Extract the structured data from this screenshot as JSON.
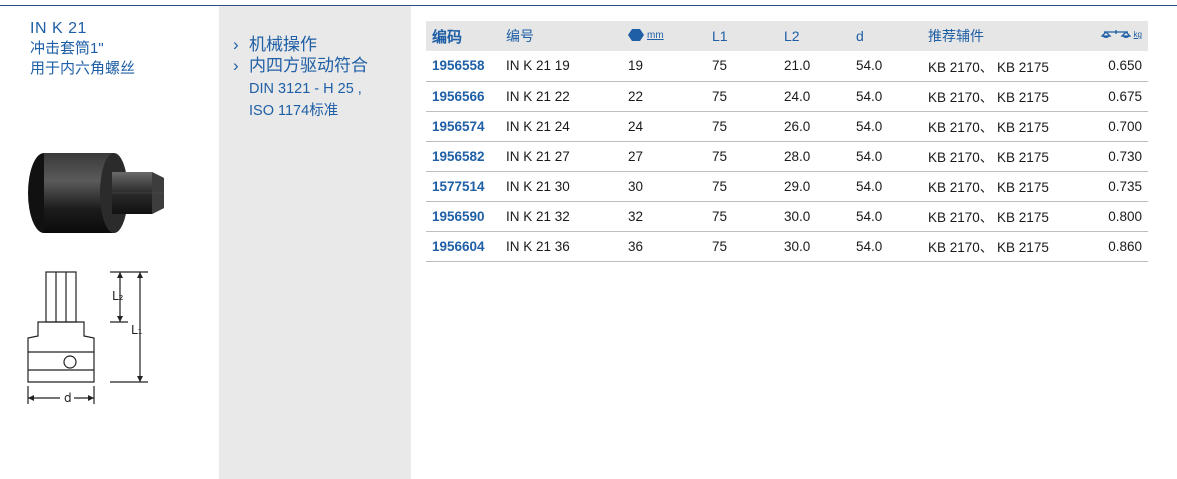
{
  "product": {
    "code": "IN K 21",
    "name_line1": "冲击套筒1\"",
    "name_line2": "用于内六角螺丝"
  },
  "features": {
    "item1": "机械操作",
    "item2": "内四方驱动符合",
    "standard_line1": "DIN 3121 - H 25 ,",
    "standard_line2": "ISO 1174标准"
  },
  "drawing": {
    "label_l2": "L₂",
    "label_l1": "L₁",
    "label_d": "d"
  },
  "table": {
    "headers": {
      "code": "编码",
      "number": "编号",
      "hex_unit": "mm",
      "l1": "L1",
      "l2": "L2",
      "d": "d",
      "accessories": "推荐辅件",
      "weight_unit": "kg"
    },
    "rows": [
      {
        "code": "1956558",
        "number": "IN K 21 19",
        "size": "19",
        "l1": "75",
        "l2": "21.0",
        "d": "54.0",
        "accessories": "KB 2170、 KB 2175",
        "weight": "0.650"
      },
      {
        "code": "1956566",
        "number": "IN K 21 22",
        "size": "22",
        "l1": "75",
        "l2": "24.0",
        "d": "54.0",
        "accessories": "KB 2170、 KB 2175",
        "weight": "0.675"
      },
      {
        "code": "1956574",
        "number": "IN K 21 24",
        "size": "24",
        "l1": "75",
        "l2": "26.0",
        "d": "54.0",
        "accessories": "KB 2170、 KB 2175",
        "weight": "0.700"
      },
      {
        "code": "1956582",
        "number": "IN K 21 27",
        "size": "27",
        "l1": "75",
        "l2": "28.0",
        "d": "54.0",
        "accessories": "KB 2170、 KB 2175",
        "weight": "0.730"
      },
      {
        "code": "1577514",
        "number": "IN K 21 30",
        "size": "30",
        "l1": "75",
        "l2": "29.0",
        "d": "54.0",
        "accessories": "KB 2170、 KB 2175",
        "weight": "0.735"
      },
      {
        "code": "1956590",
        "number": "IN K 21 32",
        "size": "32",
        "l1": "75",
        "l2": "30.0",
        "d": "54.0",
        "accessories": "KB 2170、 KB 2175",
        "weight": "0.800"
      },
      {
        "code": "1956604",
        "number": "IN K 21 36",
        "size": "36",
        "l1": "75",
        "l2": "30.0",
        "d": "54.0",
        "accessories": "KB 2170、 KB 2175",
        "weight": "0.860"
      }
    ]
  },
  "colors": {
    "brand_blue": "#1f5fa6",
    "header_grey": "#e6e6e6",
    "panel_grey": "#e9e9e9"
  }
}
